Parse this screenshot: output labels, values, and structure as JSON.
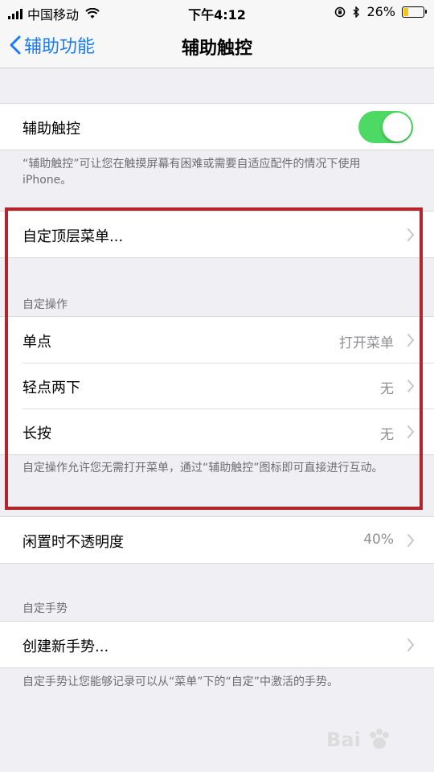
{
  "status_bar": {
    "carrier": "中国移动",
    "time": "下午4:12",
    "battery_percent": "26%",
    "battery_level": 0.26,
    "icons": [
      "signal-icon",
      "wifi-icon",
      "rotation-lock-icon",
      "bluetooth-icon",
      "battery-icon"
    ]
  },
  "nav": {
    "back_label": "辅助功能",
    "title": "辅助触控"
  },
  "assistive_touch": {
    "label": "辅助触控",
    "enabled": true,
    "footer": "“辅助触控”可让您在触摸屏幕有困难或需要自适应配件的情况下使用 iPhone。"
  },
  "top_menu": {
    "label": "自定顶层菜单..."
  },
  "custom_actions": {
    "header": "自定操作",
    "items": [
      {
        "label": "单点",
        "value": "打开菜单"
      },
      {
        "label": "轻点两下",
        "value": "无"
      },
      {
        "label": "长按",
        "value": "无"
      }
    ],
    "footer": "自定操作允许您无需打开菜单，通过“辅助触控”图标即可直接进行互动。"
  },
  "idle_opacity": {
    "label": "闲置时不透明度",
    "value": "40%"
  },
  "custom_gestures": {
    "header": "自定手势",
    "create_label": "创建新手势...",
    "footer": "自定手势让您能够记录可以从“菜单”下的“自定”中激活的手势。"
  },
  "colors": {
    "accent": "#1a7cf5",
    "toggle_on": "#4cd964",
    "highlight_border": "#b3252a"
  }
}
